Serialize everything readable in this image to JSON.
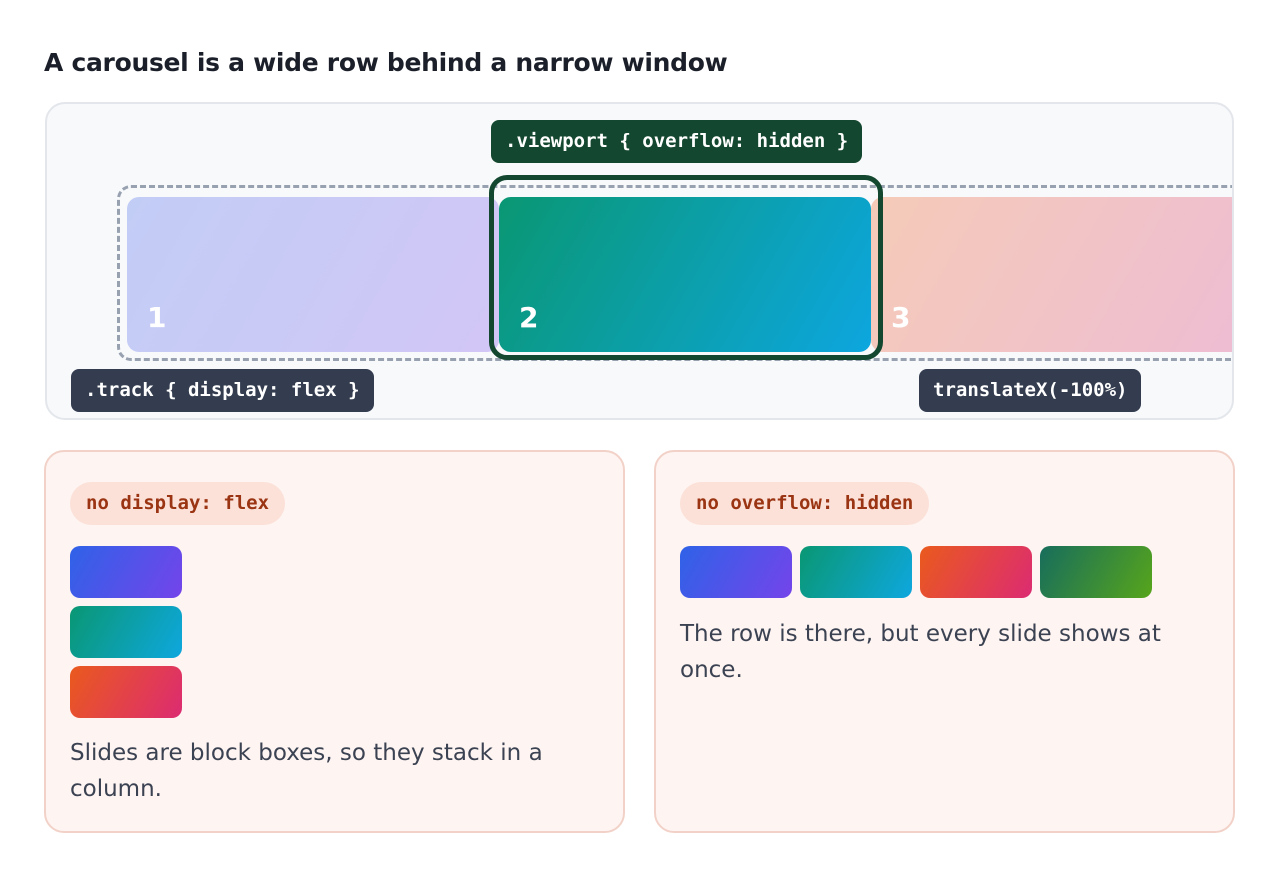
{
  "title": "A carousel is a wide row behind a narrow window",
  "hero": {
    "viewport_label": ".viewport { overflow: hidden }",
    "track_label": ".track { display: flex }",
    "translate_label": "translateX(-100%)",
    "slides": [
      {
        "number": "1",
        "colors": [
          "#c2cdf6",
          "#d2c6f6"
        ]
      },
      {
        "number": "2",
        "colors": [
          "#0a9773",
          "#0da6df"
        ]
      },
      {
        "number": "3",
        "colors": [
          "#f5cbb8",
          "#eebcd3"
        ]
      }
    ],
    "colors": {
      "viewport": "#14472f",
      "track_tag": "#333d4f",
      "track_outline": "#97a1b0"
    }
  },
  "panels": [
    {
      "pill": "no display: flex",
      "caption": "Slides are block boxes, so they stack in a column.",
      "layout": "column",
      "slide_colors": [
        [
          "#2f62e8",
          "#7444ea"
        ],
        [
          "#0a9773",
          "#0ea7de"
        ],
        [
          "#ea5a1d",
          "#dc2b72"
        ]
      ]
    },
    {
      "pill": "no overflow: hidden",
      "caption": "The row is there, but every slide shows at once.",
      "layout": "row",
      "slide_colors": [
        [
          "#2f62e8",
          "#7444ea"
        ],
        [
          "#0a9773",
          "#0ea7de"
        ],
        [
          "#ea5a1d",
          "#dc2b72"
        ],
        [
          "#176d5c",
          "#57a51b"
        ]
      ]
    }
  ]
}
